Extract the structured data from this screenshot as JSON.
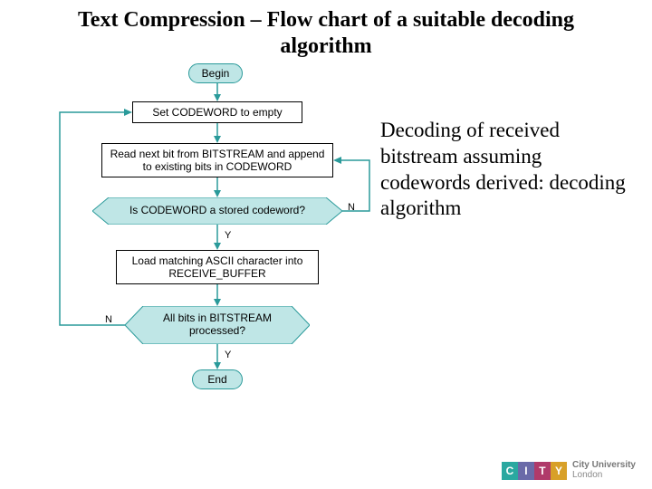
{
  "title": "Text Compression – Flow chart of a suitable decoding algorithm",
  "description": "Decoding of received bitstream assuming codewords derived: decoding algorithm",
  "flowchart": {
    "begin": "Begin",
    "set_codeword": "Set CODEWORD to empty",
    "read_bit": "Read next bit from BITSTREAM and append to existing bits in CODEWORD",
    "is_stored": "Is CODEWORD a stored codeword?",
    "load_ascii": "Load matching ASCII character into RECEIVE_BUFFER",
    "all_bits": "All bits in BITSTREAM processed?",
    "end": "End",
    "yes": "Y",
    "no": "N"
  },
  "logo": {
    "c": "C",
    "i": "I",
    "t": "T",
    "y": "Y",
    "line1": "City University",
    "line2": "London"
  }
}
